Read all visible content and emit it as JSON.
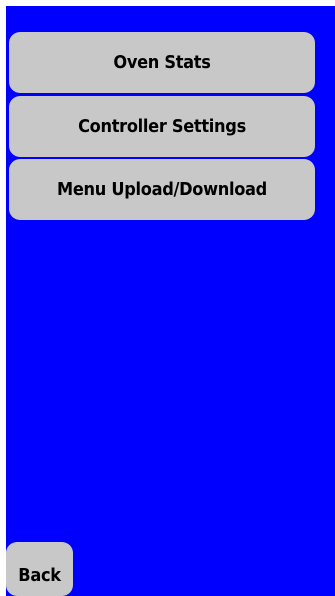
{
  "menu": {
    "items": [
      {
        "label": "Oven Stats"
      },
      {
        "label": "Controller Settings"
      },
      {
        "label": "Menu Upload/Download"
      }
    ]
  },
  "footer": {
    "back_label": "Back"
  },
  "colors": {
    "background": "#0000ff",
    "button": "#c8c8c8",
    "text": "#000000"
  }
}
